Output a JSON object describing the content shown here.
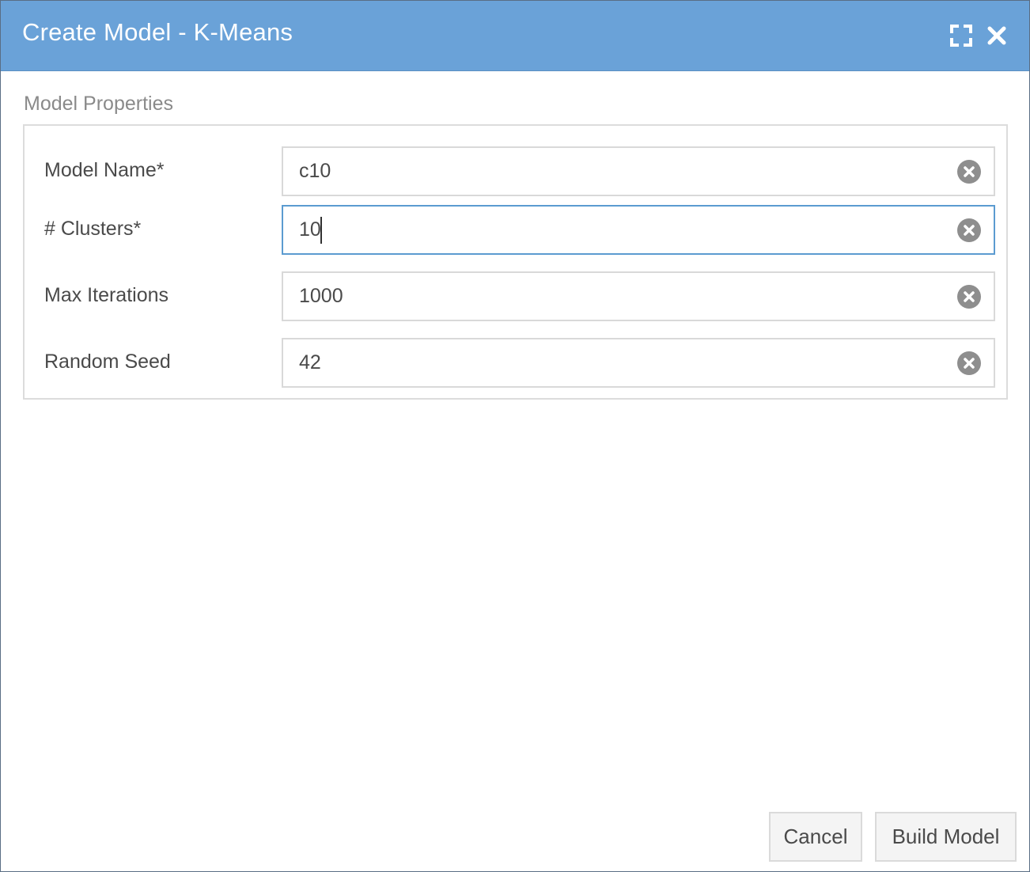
{
  "dialog": {
    "title": "Create Model - K-Means",
    "icons": {
      "maximize": "maximize-icon",
      "close": "close-icon"
    }
  },
  "section": {
    "title": "Model Properties"
  },
  "fields": [
    {
      "label": "Model Name*",
      "value": "c10",
      "focused": false
    },
    {
      "label": "# Clusters*",
      "value": "10",
      "focused": true
    },
    {
      "label": "Max Iterations",
      "value": "1000",
      "focused": false
    },
    {
      "label": "Random Seed",
      "value": "42",
      "focused": false
    }
  ],
  "buttons": {
    "cancel": "Cancel",
    "build": "Build Model"
  },
  "colors": {
    "titlebar": "#6aa2d8",
    "focus_border": "#5b9bd0",
    "clear_icon": "#8e8e8e"
  }
}
